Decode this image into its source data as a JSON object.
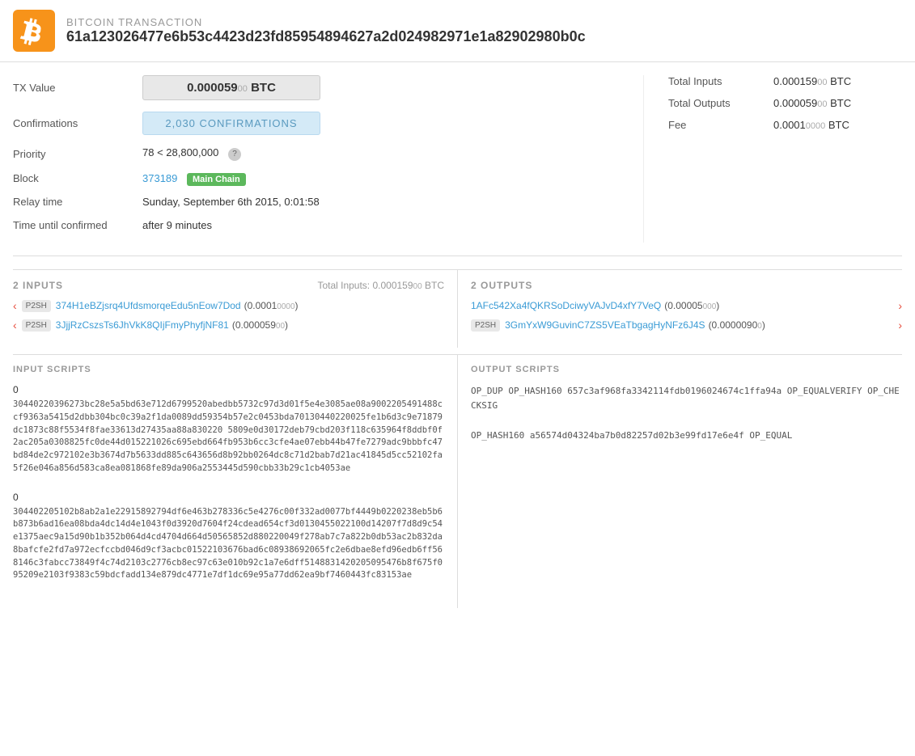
{
  "header": {
    "label": "BITCOIN TRANSACTION",
    "txid": "61a123026477e6b53c4423d23fd85954894627a2d024982971e1a82902980b0c",
    "logo_symbol": "₿"
  },
  "tx_info": {
    "tx_value_label": "TX Value",
    "tx_value": "0.000059",
    "tx_value_suffix": "00",
    "tx_value_unit": "BTC",
    "confirmations_label": "Confirmations",
    "confirmations_text": "2,030 CONFIRMATIONS",
    "priority_label": "Priority",
    "priority_value": "78 < 28,800,000",
    "block_label": "Block",
    "block_number": "373189",
    "block_badge": "Main Chain",
    "relay_time_label": "Relay time",
    "relay_time_value": "Sunday, September 6th 2015, 0:01:58",
    "time_confirmed_label": "Time until confirmed",
    "time_confirmed_value": "after 9 minutes"
  },
  "totals": {
    "total_inputs_label": "Total Inputs",
    "total_inputs_value": "0.000159",
    "total_inputs_suffix": "00",
    "total_inputs_unit": "BTC",
    "total_outputs_label": "Total Outputs",
    "total_outputs_value": "0.000059",
    "total_outputs_suffix": "00",
    "total_outputs_unit": "BTC",
    "fee_label": "Fee",
    "fee_value": "0.0001",
    "fee_suffix": "0000",
    "fee_unit": "BTC"
  },
  "inputs": {
    "section_title": "2 INPUTS",
    "total_label": "Total Inputs: 0.000159",
    "total_suffix": "00",
    "total_unit": "BTC",
    "items": [
      {
        "badge": "P2SH",
        "address": "374H1eBZjsrq4UfdsmorqeEdu5nEow7Dod",
        "amount": "(0.0001",
        "amount_suffix": "0000",
        "amount_close": ")"
      },
      {
        "badge": "P2SH",
        "address": "3JjjRzCszsTs6JhVkK8QIjFmyPhyfjNF81",
        "amount": "(0.000059",
        "amount_suffix": "00",
        "amount_close": ")"
      }
    ]
  },
  "outputs": {
    "section_title": "2 OUTPUTS",
    "items": [
      {
        "badge": null,
        "address": "1AFc542Xa4fQKRSoDciwyVAJvD4xfY7VeQ",
        "amount": "(0.00005",
        "amount_suffix": "000",
        "amount_close": ")"
      },
      {
        "badge": "P2SH",
        "address": "3GmYxW9GuvinC7ZS5VEaTbgagHyNFz6J4S",
        "amount": "(0.0000090",
        "amount_suffix": "0",
        "amount_close": ")"
      }
    ]
  },
  "input_scripts": {
    "section_title": "INPUT SCRIPTS",
    "scripts": [
      {
        "index": "0",
        "code": "30440220396273bc28e5a5bd63e712d6799520abedbb5732c97d3d01f5e4e3085ae08a9002205491488ccf9363a5415d2dbb304bc0c39a2f1da0089dd59354b57e2c0453bda70130440220025fe1b6d3c9e71879dc1873c88f5534f8fae33613d27435aa88a830220\n5809e0d30172deb79cbd203f118c635964f8ddbf0f2ac205a0308825fc0de44d015221026c695ebd664fb953b6cc3cfe4ae07ebb44b47fe7279adc9bbbfc47bd84de2c972102e3b3674d7b5633dd885c643656d8b92bb0264dc8c71d2bab7d21ac41845d5cc52102fa5f26e046a856d583ca8ea081868fe89da906a2553445d590cbb33b29c1cb4053ae"
      },
      {
        "index": "0",
        "code": "304402205102b8ab2a1e22915892794df6e463b278336c5e4276c00f332ad0077bf4449b0220238eb5b6b873b6ad16ea08bda4dc14d4e1043f0d3920d7604f24cdead654cf3d0130455022100d14207f7d8d9c54e1375aec9a15d90b1b352b064d4cd4704d664d50565852d880220049f278ab7c7a822b0db53ac2b832da8bafcfe2fd7a972ecfccbd046d9cf3acbc01522103676bad6c08938692065fc2e6dbae8efd96edb6ff568146c3fabcc73849f4c74d2103c2776cb8ec97c63e010b92c1a7e6dff5148831420205095476b8f675f095209e2103f9383c59bdcfadd134e879dc4771e7df1dc69e95a77dd62ea9bf7460443fc83153ae"
      }
    ]
  },
  "output_scripts": {
    "section_title": "OUTPUT SCRIPTS",
    "scripts": [
      {
        "code": "OP_DUP OP_HASH160 657c3af968fa3342114fdb0196024674c1ffa94a OP_EQUALVERIFY OP_CHECKSIG"
      },
      {
        "code": "OP_HASH160 a56574d04324ba7b0d82257d02b3e99fd17e6e4f OP_EQUAL"
      }
    ]
  }
}
